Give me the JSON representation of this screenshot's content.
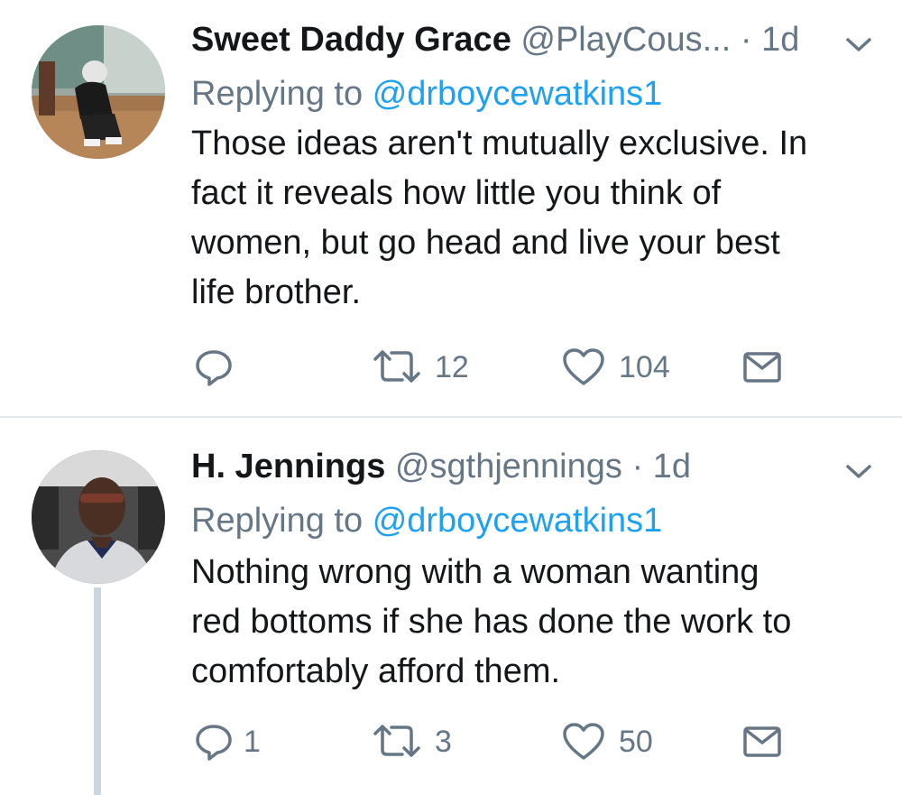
{
  "tweets": [
    {
      "name": "Sweet Daddy Grace",
      "handle": "@PlayCous...",
      "separator": "·",
      "time": "1d",
      "replying_label": "Replying to",
      "replying_handle": "@drboycewatkins1",
      "body_lines": [
        "Those ideas aren't mutually exclusive. In",
        "fact it reveals how little you think of",
        "women, but go head and live your best",
        "life brother."
      ],
      "replies": "",
      "retweets": "12",
      "likes": "104"
    },
    {
      "name": "H. Jennings",
      "handle": "@sgthjennings",
      "separator": "·",
      "time": "1d",
      "replying_label": "Replying to",
      "replying_handle": "@drboycewatkins1",
      "body_lines": [
        "Nothing wrong with a woman wanting",
        "red bottoms if she has done the work to",
        "comfortably afford them."
      ],
      "replies": "1",
      "retweets": "3",
      "likes": "50"
    }
  ],
  "icons": {
    "reply": "reply-icon",
    "retweet": "retweet-icon",
    "like": "like-icon",
    "dm": "direct-message-icon",
    "caret": "chevron-down-icon"
  },
  "colors": {
    "text": "#14171a",
    "secondary": "#657786",
    "link": "#1da1f2",
    "divider": "#e1e8ed",
    "thread_line": "#ccd6dd"
  }
}
